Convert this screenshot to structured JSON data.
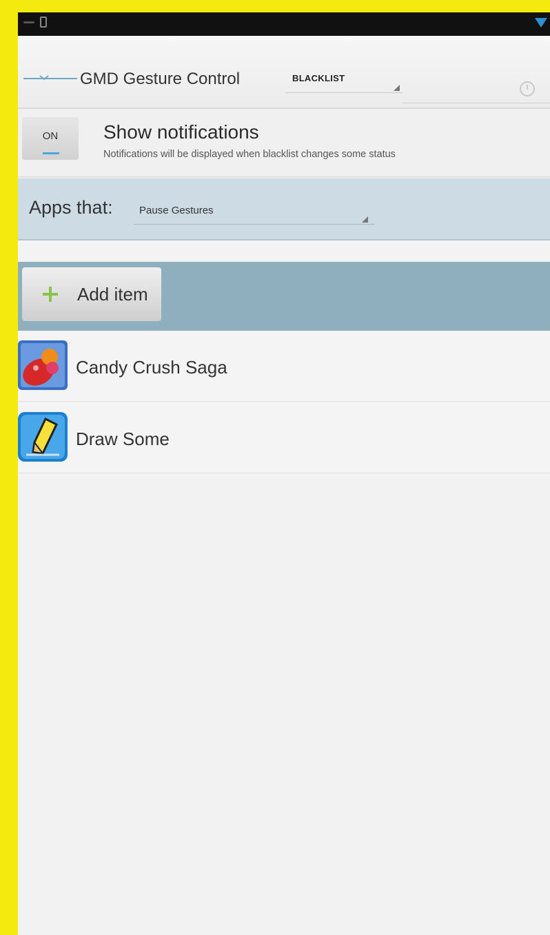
{
  "app": {
    "title": "GMD Gesture Control",
    "mode_spinner": "BLACKLIST"
  },
  "notifications": {
    "toggle_label": "ON",
    "title": "Show notifications",
    "subtitle": "Notifications will be displayed when blacklist changes some status"
  },
  "filter": {
    "label": "Apps that:",
    "selected": "Pause Gestures"
  },
  "add_item": {
    "label": "Add item"
  },
  "apps": [
    {
      "name": "Candy Crush Saga",
      "icon": "candy-crush-icon"
    },
    {
      "name": "Draw Some",
      "icon": "draw-some-icon"
    }
  ],
  "colors": {
    "frame": "#f5ea0e",
    "accent": "#2f8fd3",
    "header_band": "#cddbe4",
    "add_band": "#8fafbf",
    "add_plus": "#8bc34a"
  }
}
